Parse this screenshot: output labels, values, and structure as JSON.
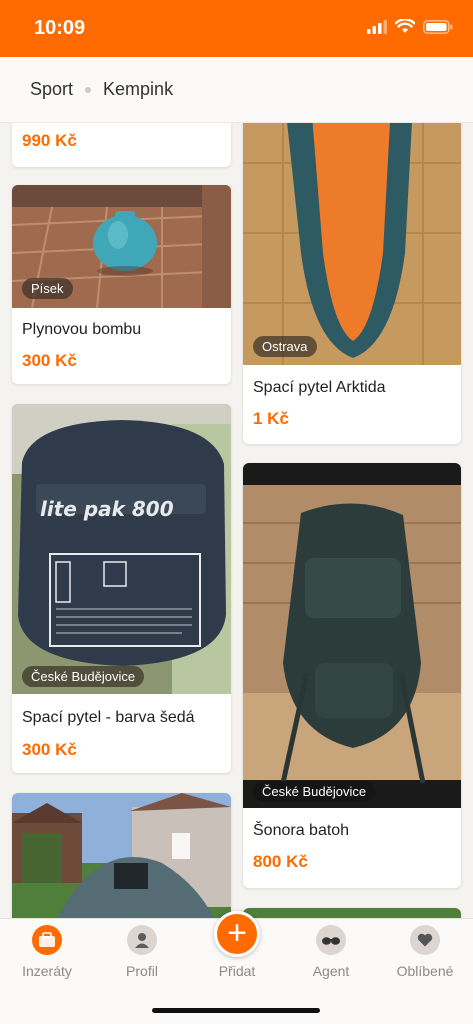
{
  "status_bar": {
    "time": "10:09"
  },
  "breadcrumb": {
    "category": "Sport",
    "subcategory": "Kempink"
  },
  "listings": [
    {
      "price": "990 Kč"
    },
    {
      "location": "Písek",
      "title": "Plynovou bombu",
      "price": "300 Kč"
    },
    {
      "location": "České Budějovice",
      "title": "Spací pytel - barva šedá",
      "price": "300 Kč",
      "image_text": "lite pak 800"
    },
    {
      "location": "Ostrava",
      "title": "Spací pytel Arktida",
      "price": "1 Kč"
    },
    {
      "location": "České Budějovice",
      "title": "Šonora batoh",
      "price": "800 Kč"
    }
  ],
  "tabbar": {
    "tabs": [
      {
        "label": "Inzeráty",
        "icon": "listings-icon"
      },
      {
        "label": "Profil",
        "icon": "profile-icon"
      },
      {
        "label": "Přidat",
        "icon": "plus-icon"
      },
      {
        "label": "Agent",
        "icon": "agent-icon"
      },
      {
        "label": "Oblíbené",
        "icon": "heart-icon"
      }
    ]
  },
  "colors": {
    "accent": "#ff6b00",
    "background": "#f5f3f0"
  }
}
